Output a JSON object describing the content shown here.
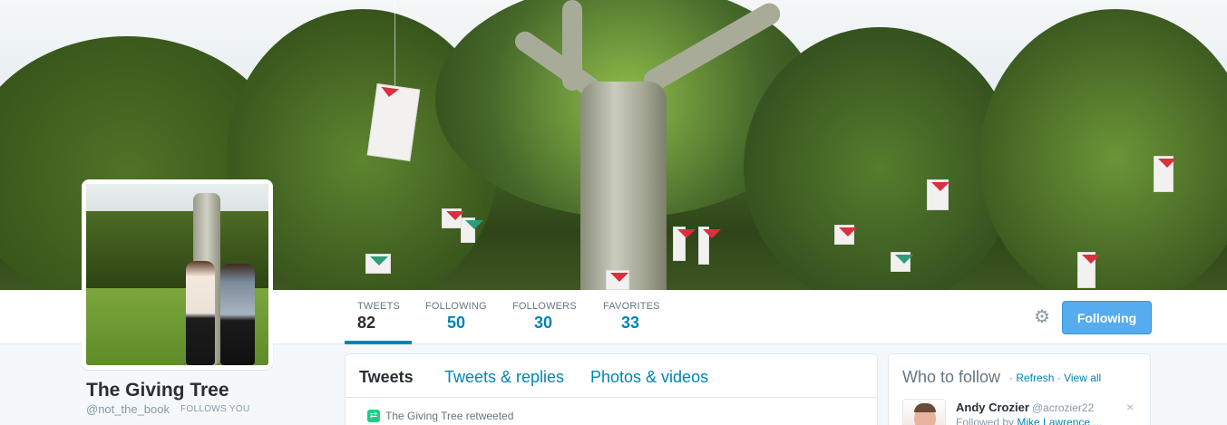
{
  "profile": {
    "name": "The Giving Tree",
    "handle": "@not_the_book",
    "follows_you": "FOLLOWS YOU"
  },
  "stats": [
    {
      "label": "TWEETS",
      "value": "82",
      "active": true
    },
    {
      "label": "FOLLOWING",
      "value": "50",
      "active": false
    },
    {
      "label": "FOLLOWERS",
      "value": "30",
      "active": false
    },
    {
      "label": "FAVORITES",
      "value": "33",
      "active": false
    }
  ],
  "actions": {
    "gear_icon": "gear-icon",
    "following_button": "Following"
  },
  "timeline": {
    "tabs": [
      {
        "label": "Tweets",
        "active": true
      },
      {
        "label": "Tweets & replies",
        "active": false
      },
      {
        "label": "Photos & videos",
        "active": false
      }
    ],
    "retweet_notice": "The Giving Tree retweeted"
  },
  "who_to_follow": {
    "title": "Who to follow",
    "refresh": "Refresh",
    "view_all": "View all",
    "separator": "·",
    "suggestion": {
      "name": "Andy Crozier",
      "handle": "@acrozier22",
      "followed_by_prefix": "Followed by",
      "followed_by_name": "Mike Lawrence",
      "ellipsis": "...",
      "close": "×"
    }
  },
  "colors": {
    "link": "#0084b4",
    "button": "#55acee",
    "retweet": "#19cf86"
  }
}
